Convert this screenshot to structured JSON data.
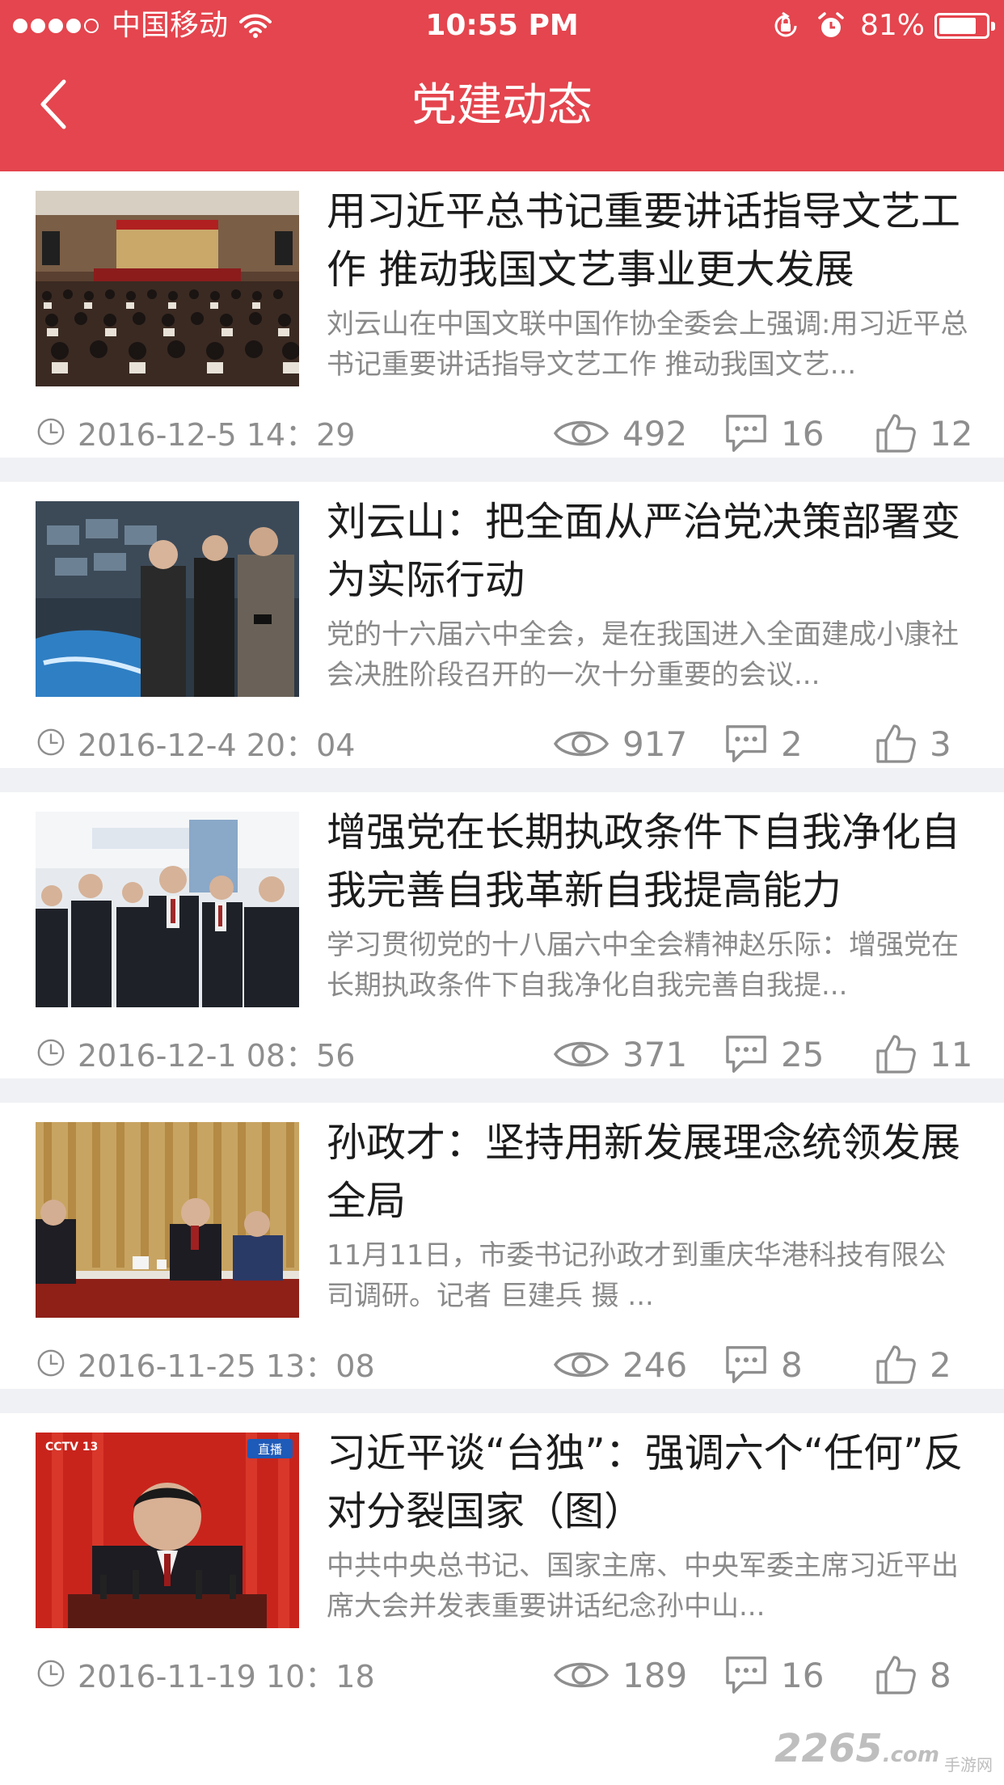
{
  "colors": {
    "header_bg": "#e4454e",
    "title_text": "#1c1c1c",
    "summary_text": "#8a8a8a",
    "meta_text": "#8e8e8e",
    "divider": "#f0f1f4"
  },
  "status_bar": {
    "carrier": "中国移动",
    "time": "10:55 PM",
    "battery_pct": "81%",
    "battery_level": 0.81
  },
  "nav": {
    "title": "党建动态",
    "back_icon": "chevron-left-icon"
  },
  "articles": [
    {
      "title": "用习近平总书记重要讲话指导文艺工作 推动我国文艺事业更大发展",
      "summary": "刘云山在中国文联中国作协全委会上强调:用习近平总书记重要讲话指导文艺工作 推动我国文艺...",
      "time": "2016-12-5 14：29",
      "views": "492",
      "comments": "16",
      "likes": "12",
      "thumb": "meeting-hall-photo"
    },
    {
      "title": "刘云山：把全面从严治党决策部署变为实际行动",
      "summary": "党的十六届六中全会，是在我国进入全面建成小康社会决胜阶段召开的一次十分重要的会议...",
      "time": "2016-12-4 20：04",
      "views": "917",
      "comments": "2",
      "likes": "3",
      "thumb": "exhibition-visit-photo"
    },
    {
      "title": "增强党在长期执政条件下自我净化自我完善自我革新自我提高能力",
      "summary": "学习贯彻党的十八届六中全会精神赵乐际：增强党在长期执政条件下自我净化自我完善自我提...",
      "time": "2016-12-1 08：56",
      "views": "371",
      "comments": "25",
      "likes": "11",
      "thumb": "officials-group-photo"
    },
    {
      "title": "孙政才：坚持用新发展理念统领发展全局",
      "summary": "11月11日，市委书记孙政才到重庆华港科技有限公司调研。记者 巨建兵 摄 ...",
      "time": "2016-11-25 13：08",
      "views": "246",
      "comments": "8",
      "likes": "2",
      "thumb": "meeting-table-photo"
    },
    {
      "title": "习近平谈“台独”：强调六个“任何”反对分裂国家（图）",
      "summary": "中共中央总书记、国家主席、中央军委主席习近平出席大会并发表重要讲话纪念孙中山...",
      "time": "2016-11-19 10：18",
      "views": "189",
      "comments": "16",
      "likes": "8",
      "thumb": "speech-broadcast-photo",
      "thumb_badges": {
        "channel": "CCTV 13",
        "live": "直播"
      }
    }
  ],
  "watermark": {
    "main": "2265",
    "suffix": ".com",
    "sub": "手游网"
  }
}
